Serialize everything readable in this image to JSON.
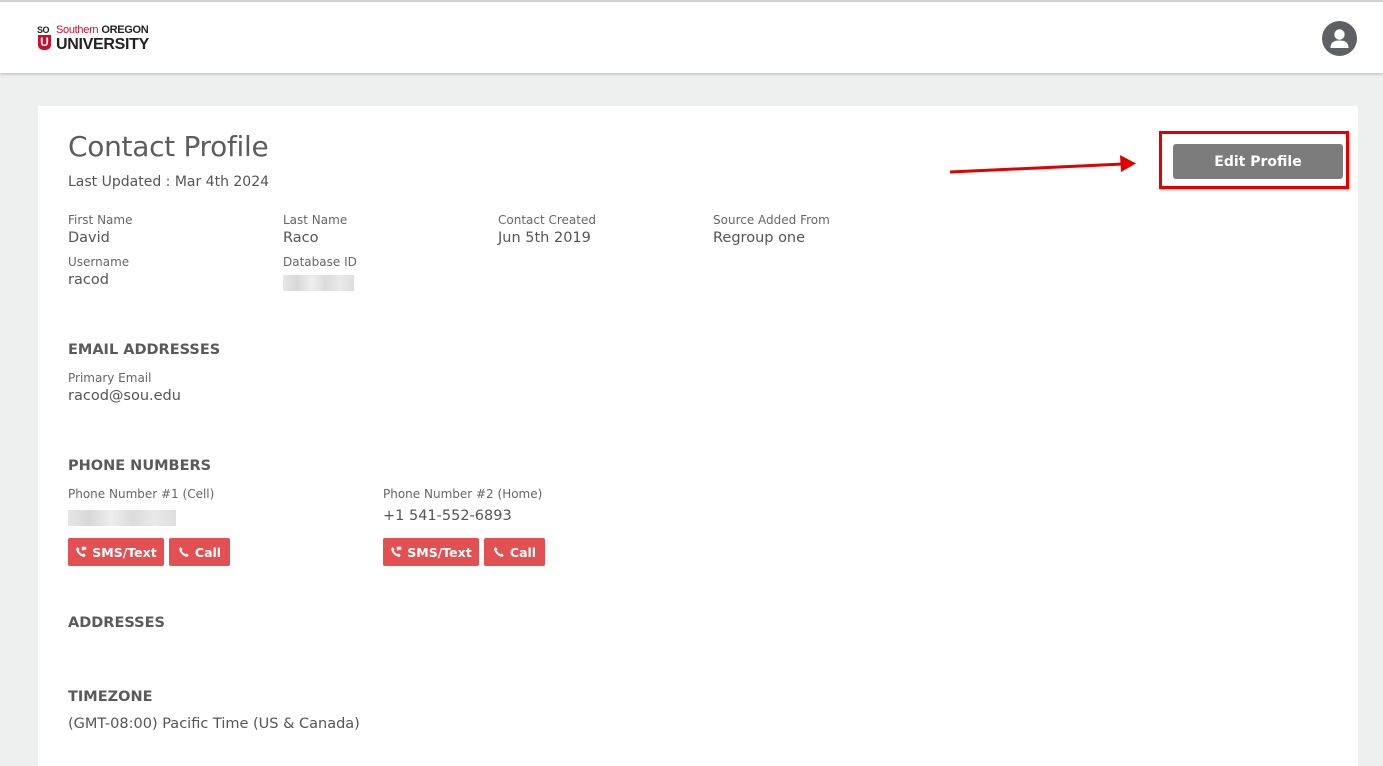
{
  "header": {
    "logo_so": "SO",
    "logo_u": "U",
    "logo_southern": "Southern",
    "logo_oregon": "OREGON",
    "logo_university": "UNIVERSITY",
    "avatar_icon": "user-icon"
  },
  "profile": {
    "title": "Contact Profile",
    "last_updated": "Last Updated : Mar 4th 2024",
    "edit_button": "Edit Profile",
    "annotation_color": "#e00000"
  },
  "fields": {
    "first_name": {
      "label": "First Name",
      "value": "David"
    },
    "last_name": {
      "label": "Last Name",
      "value": "Raco"
    },
    "contact_created": {
      "label": "Contact Created",
      "value": "Jun 5th 2019"
    },
    "source_added_from": {
      "label": "Source Added From",
      "value": "Regroup one"
    },
    "username": {
      "label": "Username",
      "value": "racod"
    },
    "database_id": {
      "label": "Database ID",
      "value": ""
    }
  },
  "email": {
    "section_title": "EMAIL ADDRESSES",
    "primary": {
      "label": "Primary Email",
      "value": "racod@sou.edu"
    }
  },
  "phones": {
    "section_title": "PHONE NUMBERS",
    "items": [
      {
        "label": "Phone Number #1 (Cell)",
        "value": "",
        "sms_label": "SMS/Text",
        "call_label": "Call"
      },
      {
        "label": "Phone Number #2 (Home)",
        "value": "+1 541-552-6893",
        "sms_label": "SMS/Text",
        "call_label": "Call"
      }
    ]
  },
  "addresses": {
    "section_title": "ADDRESSES"
  },
  "timezone": {
    "section_title": "TIMEZONE",
    "value": "(GMT-08:00) Pacific Time (US & Canada)"
  },
  "colors": {
    "button_red": "#e25052",
    "button_gray": "#7c7c7c"
  }
}
